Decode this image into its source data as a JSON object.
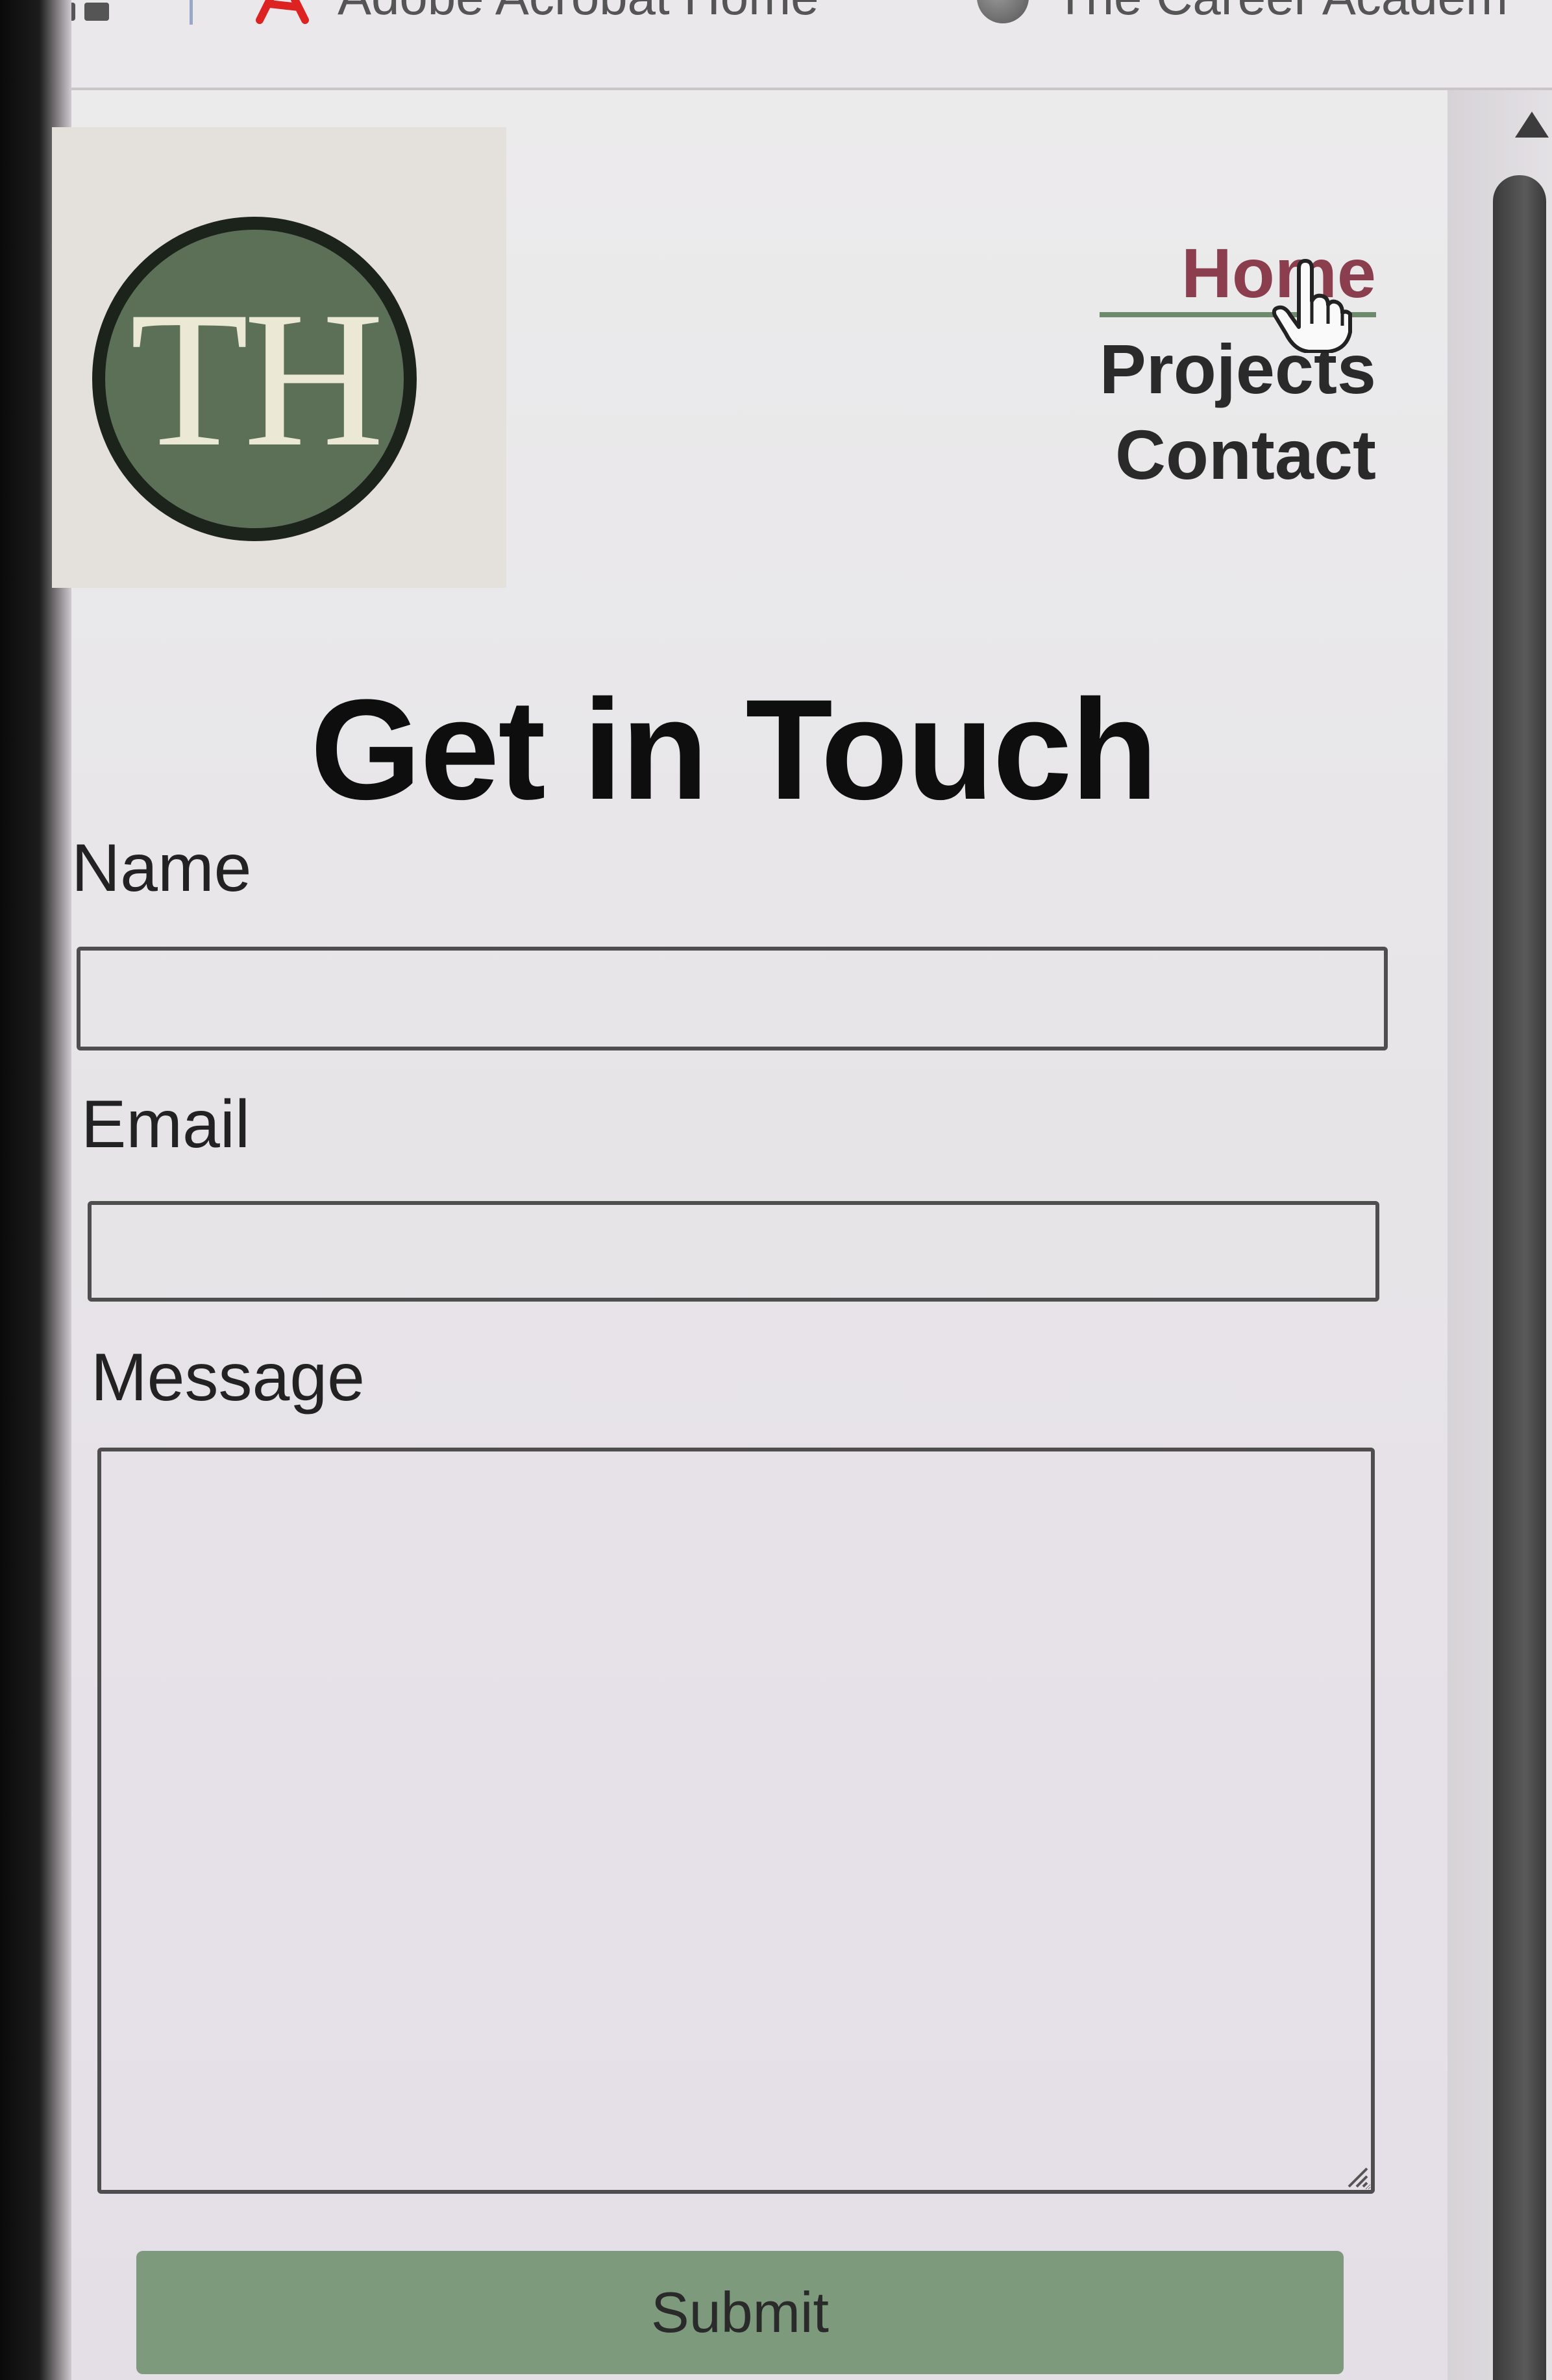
{
  "bookmarks": {
    "items": [
      {
        "label": "Adobe Acrobat Home",
        "icon": "acrobat-icon"
      },
      {
        "label": "The Career Academ",
        "icon": "globe-icon"
      }
    ]
  },
  "logo": {
    "text": "TH",
    "color": "#5c7058"
  },
  "nav": {
    "items": [
      {
        "label": "Home",
        "active": true
      },
      {
        "label": "Projects",
        "active": false
      },
      {
        "label": "Contact",
        "active": false
      }
    ],
    "active_color": "#8a3e4e"
  },
  "form": {
    "title": "Get in Touch",
    "name_label": "Name",
    "name_value": "",
    "email_label": "Email",
    "email_value": "",
    "message_label": "Message",
    "message_value": "",
    "submit_label": "Submit",
    "submit_color": "#7d9a7d"
  }
}
